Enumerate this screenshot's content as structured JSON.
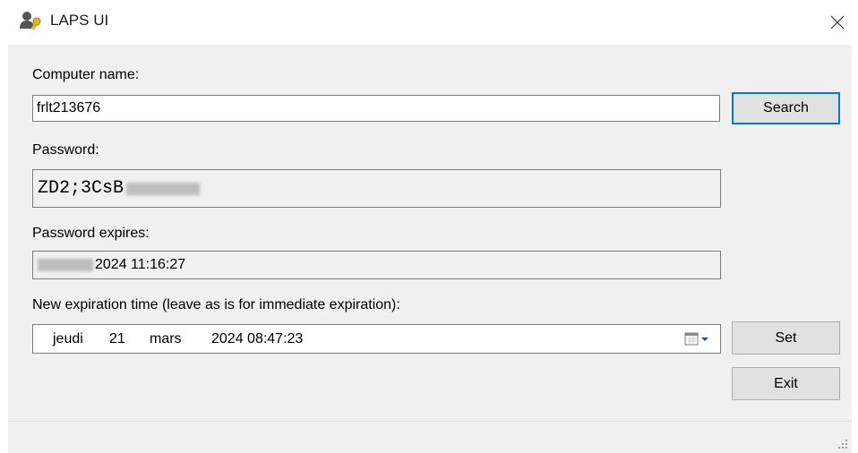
{
  "window": {
    "title": "LAPS UI",
    "icon": "laps-user-key-icon"
  },
  "form": {
    "computer_label": "Computer name:",
    "computer_value": "frlt213676",
    "search_label": "Search",
    "password_label": "Password:",
    "password_visible": "ZD2;3CsB",
    "expires_label": "Password expires:",
    "expires_visible": "2024 11:16:27",
    "new_expiration_label": "New expiration time (leave as is for immediate expiration):",
    "new_expiration": {
      "day_name": "jeudi",
      "day": "21",
      "month": "mars",
      "year_time": "2024 08:47:23"
    },
    "set_label": "Set",
    "exit_label": "Exit"
  }
}
